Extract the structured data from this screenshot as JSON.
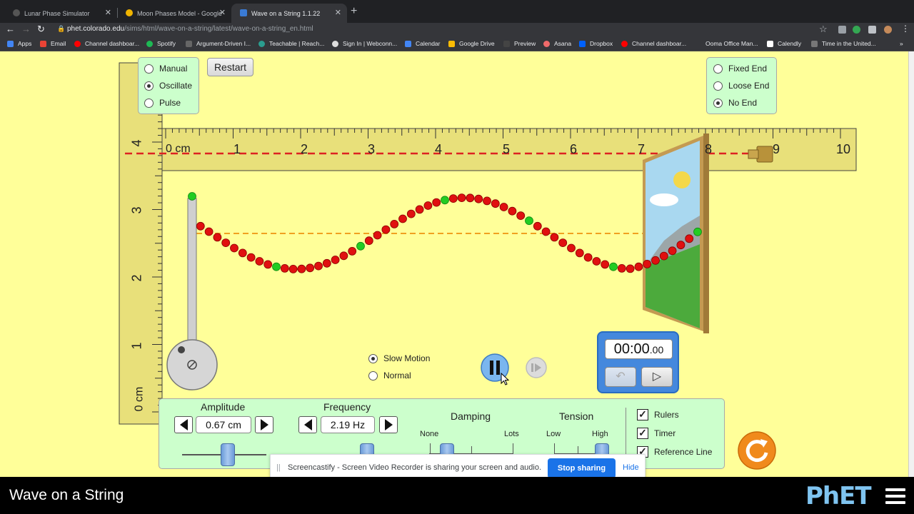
{
  "browser": {
    "tabs": [
      {
        "title": "Lunar Phase Simulator",
        "active": false
      },
      {
        "title": "Moon Phases Model - Google",
        "active": false
      },
      {
        "title": "Wave on a String 1.1.22",
        "active": true
      }
    ],
    "url_host": "phet.colorado.edu",
    "url_path": "/sims/html/wave-on-a-string/latest/wave-on-a-string_en.html",
    "bookmarks": [
      "Apps",
      "Email",
      "Channel dashboar...",
      "Spotify",
      "Argument-Driven I...",
      "Teachable | Reach...",
      "Sign In | Webconn...",
      "Calendar",
      "Google Drive",
      "Preview",
      "Asana",
      "Dropbox",
      "Channel dashboar...",
      "Ooma Office Man...",
      "Calendly",
      "Time in the United..."
    ]
  },
  "sim": {
    "mode_options": [
      {
        "label": "Manual",
        "selected": false
      },
      {
        "label": "Oscillate",
        "selected": true
      },
      {
        "label": "Pulse",
        "selected": false
      }
    ],
    "restart_label": "Restart",
    "end_options": [
      {
        "label": "Fixed End",
        "selected": false
      },
      {
        "label": "Loose End",
        "selected": false
      },
      {
        "label": "No End",
        "selected": true
      }
    ],
    "ruler_h": {
      "unit_label": "0 cm",
      "ticks": [
        "1",
        "2",
        "3",
        "4",
        "5",
        "6",
        "7",
        "8",
        "9",
        "10"
      ]
    },
    "ruler_v": {
      "unit_label": "0 cm",
      "ticks": [
        "1",
        "2",
        "3",
        "4"
      ]
    },
    "speed_options": [
      {
        "label": "Slow Motion",
        "selected": true
      },
      {
        "label": "Normal",
        "selected": false
      }
    ],
    "timer": {
      "main": "00:00",
      "fraction": ".00"
    },
    "amplitude": {
      "label": "Amplitude",
      "value": "0.67 cm"
    },
    "frequency": {
      "label": "Frequency",
      "value": "2.19 Hz"
    },
    "damping": {
      "label": "Damping",
      "min_label": "None",
      "max_label": "Lots"
    },
    "tension": {
      "label": "Tension",
      "min_label": "Low",
      "max_label": "High"
    },
    "checkboxes": [
      {
        "label": "Rulers",
        "checked": true
      },
      {
        "label": "Timer",
        "checked": true
      },
      {
        "label": "Reference Line",
        "checked": true
      }
    ]
  },
  "screen_share": {
    "message": "Screencastify - Screen Video Recorder is sharing your screen and audio.",
    "stop_label": "Stop sharing",
    "hide_label": "Hide"
  },
  "footer": {
    "title": "Wave on a String",
    "logo": "PhET"
  },
  "colors": {
    "sim_background": "#ffff99",
    "panel": "#ccffcc",
    "bead_red": "#e01010",
    "bead_green": "#22cc22",
    "ruler": "#e8e07a",
    "accent_blue": "#1a73e8"
  }
}
